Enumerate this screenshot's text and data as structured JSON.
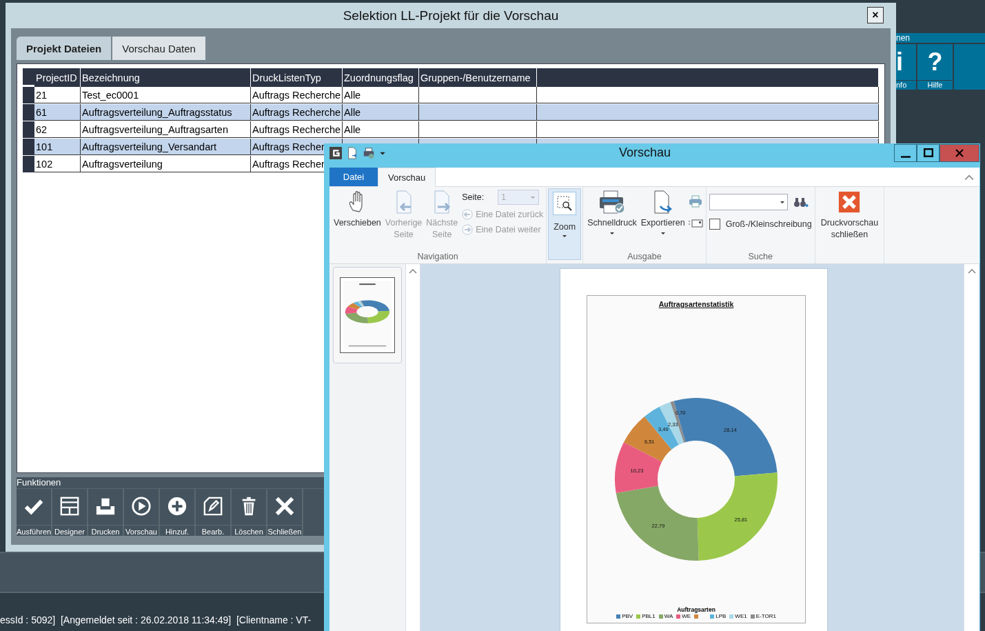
{
  "background_app": {
    "panel_title": "nen",
    "tiles": [
      {
        "glyph": "i",
        "label": "nfo"
      },
      {
        "glyph": "?",
        "label": "Hilfe"
      }
    ],
    "status_bar": "essId : 5092]  [Angemeldet seit : 26.02.2018 11:34:49]  [Clientname : VT-"
  },
  "dialog": {
    "title": "Selektion LL-Projekt für die Vorschau",
    "close": "×",
    "tabs": [
      {
        "label": "Projekt Dateien",
        "selected": true
      },
      {
        "label": "Vorschau Daten",
        "selected": false
      }
    ],
    "table": {
      "columns": [
        "ProjectID",
        "Bezeichnung",
        "DruckListenTyp",
        "Zuordnungsflag",
        "Gruppen-/Benutzername"
      ],
      "rows": [
        {
          "cells": [
            "21",
            "Test_ec0001",
            "Auftrags Recherche",
            "Alle"
          ],
          "selected": false
        },
        {
          "cells": [
            "61",
            "Auftragsverteilung_Auftragsstatus",
            "Auftrags Recherche",
            "Alle"
          ],
          "selected": true
        },
        {
          "cells": [
            "62",
            "Auftragsverteilung_Auftragsarten",
            "Auftrags Recherche",
            "Alle"
          ],
          "selected": false
        },
        {
          "cells": [
            "101",
            "Auftragsverteilung_Versandart",
            "Auftrags Recher"
          ],
          "selected": true
        },
        {
          "cells": [
            "102",
            "Auftragsverteilung",
            "Auftrags Recher"
          ],
          "selected": false
        }
      ]
    },
    "functions": {
      "title": "Funktionen",
      "buttons": [
        {
          "label": "Ausführen",
          "kind": "check"
        },
        {
          "label": "Designer",
          "kind": "layout"
        },
        {
          "label": "Drucken",
          "kind": "tray"
        },
        {
          "label": "Vorschau",
          "kind": "play"
        },
        {
          "label": "Hinzuf.",
          "kind": "plus"
        },
        {
          "label": "Bearb.",
          "kind": "edit"
        },
        {
          "label": "Löschen",
          "kind": "trash"
        },
        {
          "label": "Schließen",
          "kind": "cross"
        }
      ]
    }
  },
  "preview_window": {
    "title": "Vorschau",
    "tabs": [
      {
        "label": "Datei",
        "kind": "file",
        "selected": false
      },
      {
        "label": "Vorschau",
        "kind": "tab",
        "selected": true
      }
    ],
    "navigation": {
      "label": "Navigation",
      "buttons": [
        {
          "label": "Verschieben",
          "kind": "hand",
          "disabled": false
        },
        {
          "label": "Vorherige Seite",
          "kind": "prev",
          "disabled": true
        },
        {
          "label": "Nächste Seite",
          "kind": "next",
          "disabled": true
        }
      ],
      "page_label": "Seite:",
      "page_value": "1",
      "links": [
        {
          "label": "Eine Datei zurück",
          "kind": "back",
          "disabled": true
        },
        {
          "label": "Eine Datei weiter",
          "kind": "forward",
          "disabled": true
        }
      ]
    },
    "zoom": {
      "label": "Zoom",
      "pressed": true
    },
    "output": {
      "label": "Ausgabe",
      "buttons": [
        {
          "label": "Schnelldruck",
          "kind": "print"
        },
        {
          "label": "Exportieren",
          "kind": "export"
        }
      ]
    },
    "search": {
      "label": "Suche",
      "checkbox": {
        "label": "Groß-/Kleinschreibung",
        "checked": false
      }
    },
    "close_preview": {
      "label": "Druckvorschau schließen"
    },
    "page": {
      "chart_data": {
        "type": "donut",
        "title": "Auftragsartenstatistik",
        "categories": [
          "PBV",
          "PBL1",
          "WA",
          "WE",
          null,
          "LPB",
          "WE1",
          "E-TOR1"
        ],
        "series": [
          {
            "name": "Auftragsarten",
            "values": [
              28.14,
              25.81,
              22.79,
              10.23,
              6.51,
              3.49,
              2.33,
              0.7
            ],
            "colors": [
              "#4580b4",
              "#9bc84a",
              "#86a866",
              "#e95c80",
              "#d0873c",
              "#5db3dc",
              "#a9d8e8",
              "#8c8c8c"
            ]
          }
        ],
        "data_labels": "value_labels",
        "legend": "bottom",
        "value_labels": [
          "28,14",
          "25,81",
          "22,79",
          "10,23",
          "6,51",
          "3,49",
          "2,33",
          "0,70"
        ]
      }
    }
  }
}
